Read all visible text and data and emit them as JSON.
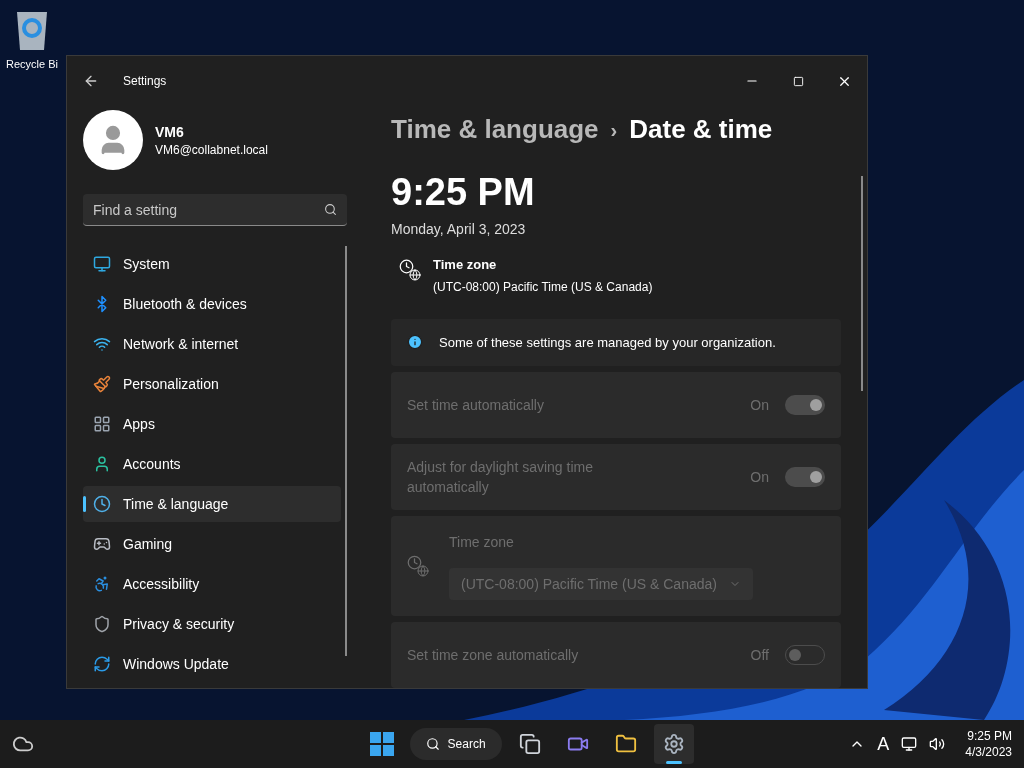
{
  "desktop": {
    "icons": [
      {
        "label": "Recycle Bi"
      }
    ]
  },
  "window": {
    "title": "Settings",
    "user": {
      "name": "VM6",
      "email": "VM6@collabnet.local"
    },
    "search": {
      "placeholder": "Find a setting"
    },
    "nav": [
      {
        "label": "System",
        "selected": false
      },
      {
        "label": "Bluetooth & devices",
        "selected": false
      },
      {
        "label": "Network & internet",
        "selected": false
      },
      {
        "label": "Personalization",
        "selected": false
      },
      {
        "label": "Apps",
        "selected": false
      },
      {
        "label": "Accounts",
        "selected": false
      },
      {
        "label": "Time & language",
        "selected": true
      },
      {
        "label": "Gaming",
        "selected": false
      },
      {
        "label": "Accessibility",
        "selected": false
      },
      {
        "label": "Privacy & security",
        "selected": false
      },
      {
        "label": "Windows Update",
        "selected": false
      }
    ],
    "breadcrumb": {
      "parent": "Time & language",
      "separator": "›",
      "current": "Date & time"
    },
    "clock": {
      "time": "9:25 PM",
      "date": "Monday, April 3, 2023"
    },
    "time_zone_summary": {
      "label": "Time zone",
      "value": "(UTC-08:00) Pacific Time (US & Canada)"
    },
    "notice": "Some of these settings are managed by your organization.",
    "settings": [
      {
        "kind": "toggle",
        "label": "Set time automatically",
        "state_text": "On",
        "on": true,
        "disabled": true
      },
      {
        "kind": "toggle",
        "label": "Adjust for daylight saving time automatically",
        "state_text": "On",
        "on": true,
        "disabled": true
      },
      {
        "kind": "dropdown",
        "label": "Time zone",
        "value": "(UTC-08:00) Pacific Time (US & Canada)",
        "disabled": true
      },
      {
        "kind": "toggle",
        "label": "Set time zone automatically",
        "state_text": "Off",
        "on": false,
        "disabled": true
      }
    ]
  },
  "taskbar": {
    "search_label": "Search",
    "keyboard_label": "A",
    "apps": [
      {
        "selected": false
      },
      {
        "selected": false
      },
      {
        "selected": false
      },
      {
        "selected": true
      }
    ],
    "time": "9:25 PM",
    "date": "4/3/2023"
  }
}
